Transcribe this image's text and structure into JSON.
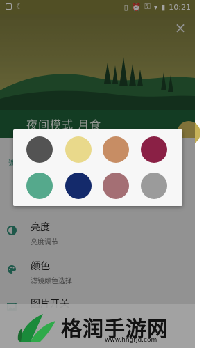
{
  "status_bar": {
    "time": "10:21"
  },
  "header": {
    "title": "夜间模式 月食",
    "close_symbol": "×"
  },
  "section": {
    "label": "遮"
  },
  "settings_rows": [
    {
      "title": "亮度",
      "subtitle": "亮度调节"
    },
    {
      "title": "颜色",
      "subtitle": "滤镜颜色选择"
    },
    {
      "title": "图片开关",
      "subtitle": ""
    }
  ],
  "color_picker": {
    "swatches": [
      {
        "color": "#535353"
      },
      {
        "color": "#e9d98b"
      },
      {
        "color": "#c78d64"
      },
      {
        "color": "#8a2045"
      },
      {
        "color": "#55a98c"
      },
      {
        "color": "#142a6b"
      },
      {
        "color": "#a46f74"
      },
      {
        "color": "#9b9b9b"
      }
    ]
  },
  "watermark": {
    "text": "格润手游网",
    "url": "www.hngrjd.com"
  },
  "colors": {
    "accent": "#2f8a74",
    "header_dark": "#1f5e38"
  }
}
